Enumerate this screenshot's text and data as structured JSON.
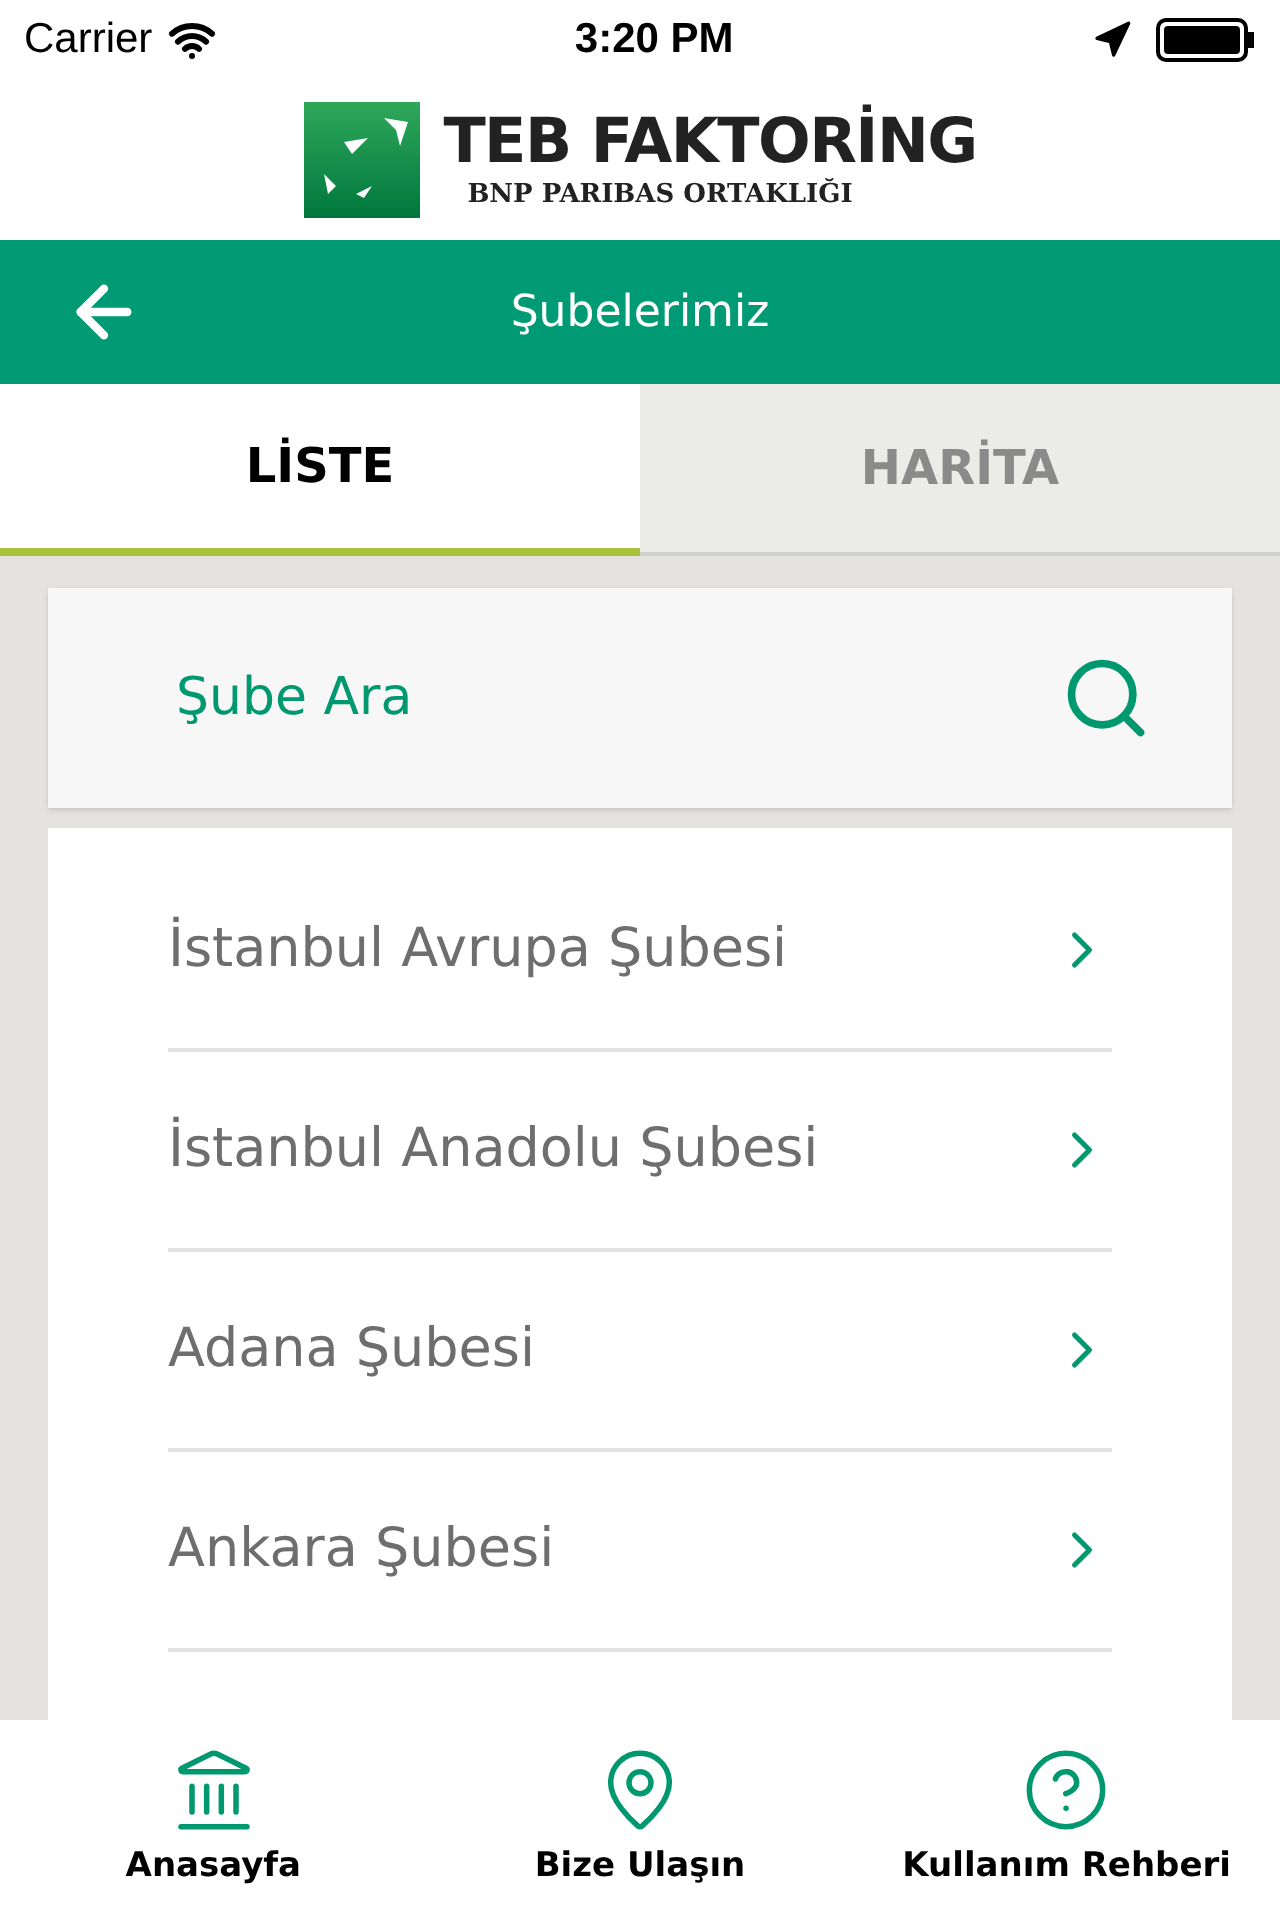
{
  "status_bar": {
    "carrier": "Carrier",
    "time": "3:20 PM"
  },
  "logo": {
    "title": "TEB FAKTORİNG",
    "subtitle": "BNP PARIBAS ORTAKLIĞI"
  },
  "header": {
    "title": "Şubelerimiz"
  },
  "tabs": [
    {
      "label": "LİSTE",
      "selected": true
    },
    {
      "label": "HARİTA",
      "selected": false
    }
  ],
  "search": {
    "placeholder": "Şube Ara"
  },
  "branches": [
    {
      "name": "İstanbul Avrupa Şubesi"
    },
    {
      "name": "İstanbul Anadolu Şubesi"
    },
    {
      "name": "Adana Şubesi"
    },
    {
      "name": "Ankara Şubesi"
    }
  ],
  "bottom_nav": [
    {
      "kind": "home",
      "label": "Anasayfa"
    },
    {
      "kind": "contact",
      "label": "Bize Ulaşın"
    },
    {
      "kind": "help",
      "label": "Kullanım Rehberi"
    }
  ]
}
